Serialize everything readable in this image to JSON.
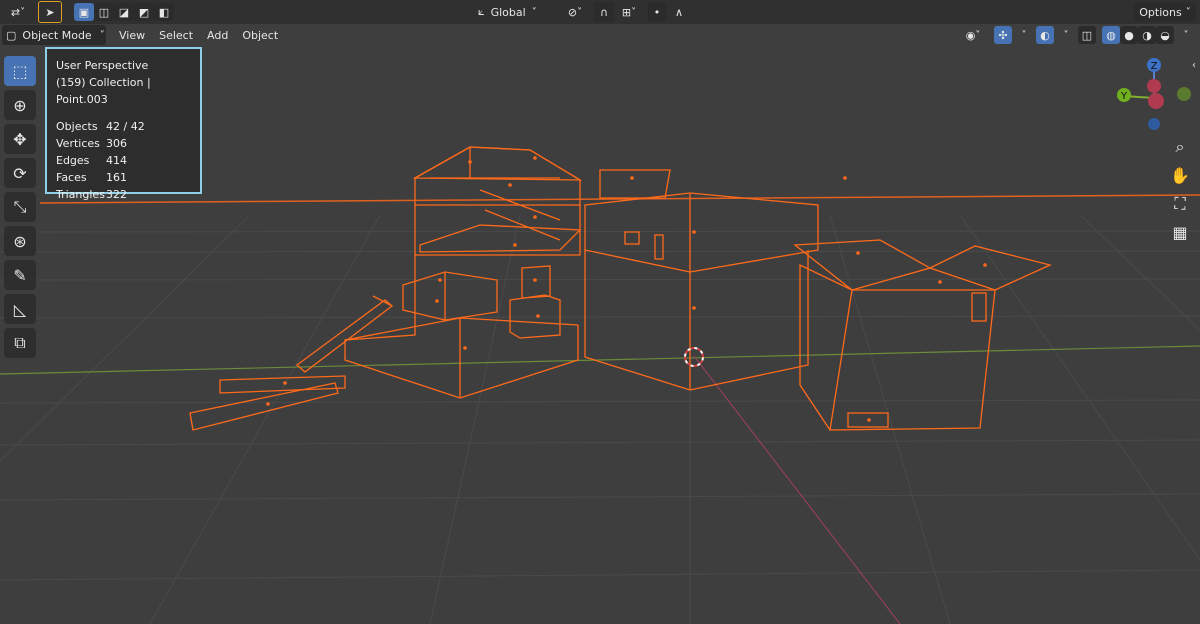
{
  "topbar": {
    "transform_orientation": "Global",
    "options_label": "Options"
  },
  "header": {
    "mode_label": "Object Mode",
    "menus": [
      "View",
      "Select",
      "Add",
      "Object"
    ]
  },
  "overlay": {
    "view_name": "User Perspective",
    "context": "(159) Collection | Point.003",
    "stats": [
      {
        "label": "Objects",
        "value": "42 / 42"
      },
      {
        "label": "Vertices",
        "value": "306"
      },
      {
        "label": "Edges",
        "value": "414"
      },
      {
        "label": "Faces",
        "value": "161"
      },
      {
        "label": "Triangles",
        "value": "322"
      }
    ]
  },
  "gizmo": {
    "z_label": "Z",
    "y_label": "Y"
  },
  "toolbar": {
    "icons": [
      "select-box-icon",
      "cursor-icon",
      "move-icon",
      "rotate-icon",
      "scale-icon",
      "transform-icon",
      "annotate-icon",
      "measure-icon",
      "add-cube-icon"
    ]
  },
  "colors": {
    "wire": "#ff6a1a",
    "accent": "#4772b3",
    "overlay_border": "#8fd0e6"
  }
}
